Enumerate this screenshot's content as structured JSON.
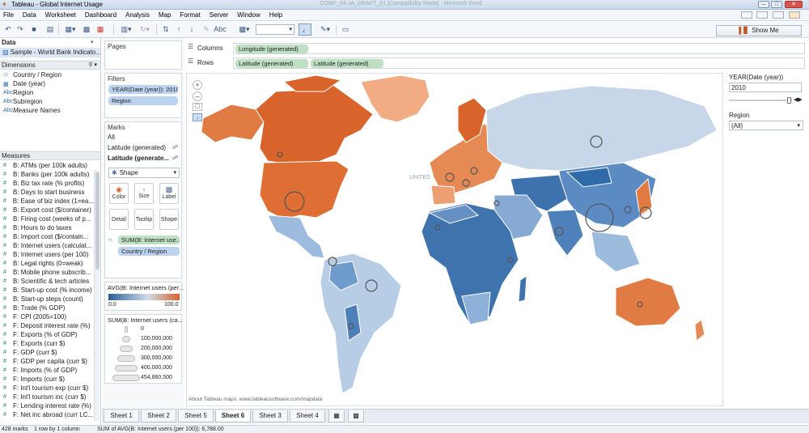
{
  "window": {
    "title": "Tableau - Global Internet Usage",
    "doc_title": "COMP_04-JA_DRAFT_01 [Compatibility Mode] - Microsoft Word"
  },
  "menu": [
    "File",
    "Data",
    "Worksheet",
    "Dashboard",
    "Analysis",
    "Map",
    "Format",
    "Server",
    "Window",
    "Help"
  ],
  "toolbar": {
    "show_me_label": "Show Me",
    "abc_label": "Abc"
  },
  "data_pane": {
    "header": "Data",
    "datasource": "Sample - World Bank Indicato...",
    "dimensions_header": "Dimensions",
    "dimensions": [
      {
        "icon": "globe",
        "label": "Country / Region"
      },
      {
        "icon": "calendar",
        "label": "Date (year)"
      },
      {
        "icon": "Abc",
        "label": "Region"
      },
      {
        "icon": "Abc",
        "label": "Subregion"
      },
      {
        "icon": "Abc",
        "label": "Measure Names"
      }
    ],
    "measures_header": "Measures",
    "measures": [
      "B: ATMs (per 100k adults)",
      "B: Banks (per 100k adults)",
      "B: Biz tax rate (% profits)",
      "B: Days to start business",
      "B: Ease of biz index (1=ea...",
      "B: Export cost ($/container)",
      "B: Firing cost (weeks of p...",
      "B: Hours to do taxes",
      "B: Import cost ($/contain...",
      "B: Internet users (calculat...",
      "B: Internet users (per 100)",
      "B: Legal rights (0=weak)",
      "B: Mobile phone subscrib...",
      "B: Scientific & tech articles",
      "B: Start-up cost (% income)",
      "B: Start-up steps (count)",
      "B: Trade (% GDP)",
      "F: CPI (2005=100)",
      "F: Deposit interest rate (%)",
      "F: Exports (% of GDP)",
      "F: Exports (curr $)",
      "F: GDP (curr $)",
      "F: GDP per capita (curr $)",
      "F: Imports (% of GDP)",
      "F: Imports (curr $)",
      "F: Int'l tourism exp (curr $)",
      "F: Int'l tourism inc (curr $)",
      "F: Lending interest rate (%)",
      "F: Net inc abroad (curr LC..."
    ]
  },
  "pages_label": "Pages",
  "filters": {
    "header": "Filters",
    "pills": [
      "YEAR(Date (year)): 2010",
      "Region"
    ]
  },
  "marks": {
    "header": "Marks",
    "all_label": "All",
    "layers": [
      "Latitude (generated)",
      "Latitude (generate..."
    ],
    "mark_type": "Shape",
    "buttons": [
      "Color",
      "Size",
      "Label",
      "Detail",
      "Tooltip",
      "Shape"
    ],
    "pills": [
      "SUM(B: Internet use..",
      "Country / Region"
    ]
  },
  "color_legend": {
    "title": "AVG(B: Internet users (per...",
    "min": "0.0",
    "max": "100.0"
  },
  "size_legend": {
    "title": "SUM(B: Internet users (ca...",
    "entries": [
      "0",
      "100,000,000",
      "200,000,000",
      "300,000,000",
      "400,000,000",
      "454,860,500"
    ]
  },
  "shelves": {
    "columns_label": "Columns",
    "rows_label": "Rows",
    "columns": [
      "Longitude (generated)"
    ],
    "rows": [
      "Latitude (generated)",
      "Latitude (generated)"
    ]
  },
  "map": {
    "attribution": "About Tableau maps: www.tableausoftware.com/mapdata",
    "united_label": "UNITED",
    "colors": {
      "ocean": "#ffffff",
      "high": "#d8632b",
      "low": "#2a5e9a",
      "mid": "#cfdce9"
    }
  },
  "year_filter": {
    "title": "YEAR(Date (year))",
    "value": "2010",
    "level": 0.97
  },
  "region_filter": {
    "title": "Region",
    "value": "(All)"
  },
  "sheets": {
    "tabs": [
      "Sheet 1",
      "Sheet 2",
      "Sheet 5",
      "Sheet 6",
      "Sheet 3",
      "Sheet 4"
    ],
    "active": "Sheet 6"
  },
  "status": {
    "marks": "428 marks",
    "rows": "1 row by 1 column",
    "sum": "SUM of AVG(B: Internet users (per 100)): 6,788.00"
  }
}
